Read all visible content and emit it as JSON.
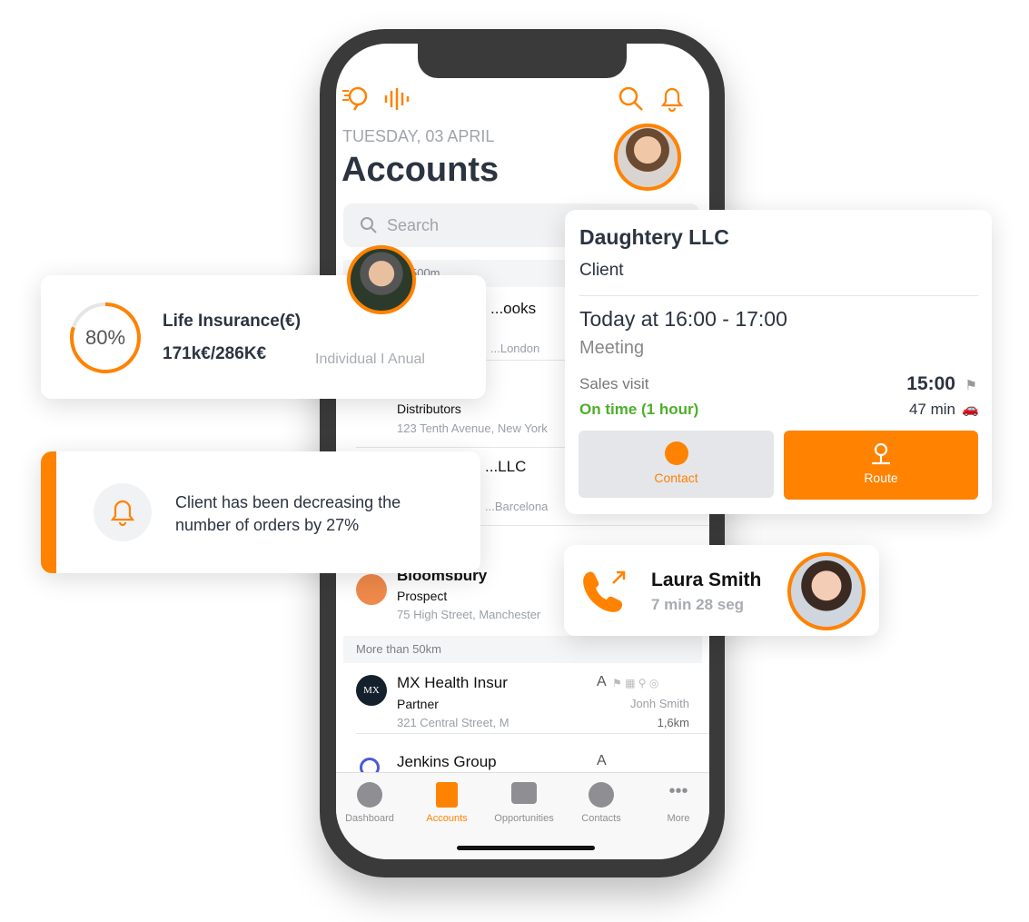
{
  "phone": {
    "date": "TUESDAY, 03 APRIL",
    "title": "Accounts",
    "search_placeholder": "Search",
    "sections": [
      "Less than 500m",
      "",
      "More than 50km"
    ],
    "rows": [
      {
        "name": "...ooks",
        "address": "...London"
      },
      {
        "type": "Distributors",
        "address": "123 Tenth Avenue, New York"
      },
      {
        "name": "...LLC",
        "address": "...Barcelona"
      },
      {
        "name": "Bloomsbury",
        "type": "Prospect",
        "address": "75 High Street, Manchester"
      },
      {
        "name": "MX Health Insur",
        "type": "Partner",
        "address": "321 Central Street, M",
        "owner": "Jonh Smith",
        "distance": "1,6km",
        "rating": "A",
        "logo": "MX"
      },
      {
        "name": "Jenkins Group",
        "rating": "A"
      }
    ],
    "tabs": [
      {
        "label": "Dashboard",
        "icon": "gauge-icon"
      },
      {
        "label": "Accounts",
        "icon": "building-icon",
        "active": true
      },
      {
        "label": "Opportunities",
        "icon": "briefcase-icon"
      },
      {
        "label": "Contacts",
        "icon": "user-icon"
      },
      {
        "label": "More",
        "icon": "more-icon"
      }
    ]
  },
  "insurance": {
    "percent_label": "80%",
    "progress": 0.8,
    "title": "Life Insurance(€)",
    "amount": "171k€/286K€",
    "sub": "Individual I Anual"
  },
  "alert": {
    "text": "Client has been decreasing the number of orders by 27%"
  },
  "meeting": {
    "company": "Daughtery LLC",
    "type": "Client",
    "time": "Today at 16:00 - 17:00",
    "kind": "Meeting",
    "purpose": "Sales visit",
    "status": "On time (1 hour)",
    "eta": "15:00",
    "travel": "47 min",
    "contact_label": "Contact",
    "route_label": "Route"
  },
  "call": {
    "name": "Laura Smith",
    "duration": "7 min 28 seg"
  },
  "colors": {
    "accent": "#ff8200",
    "green": "#4caf2a",
    "text": "#2b3440"
  }
}
